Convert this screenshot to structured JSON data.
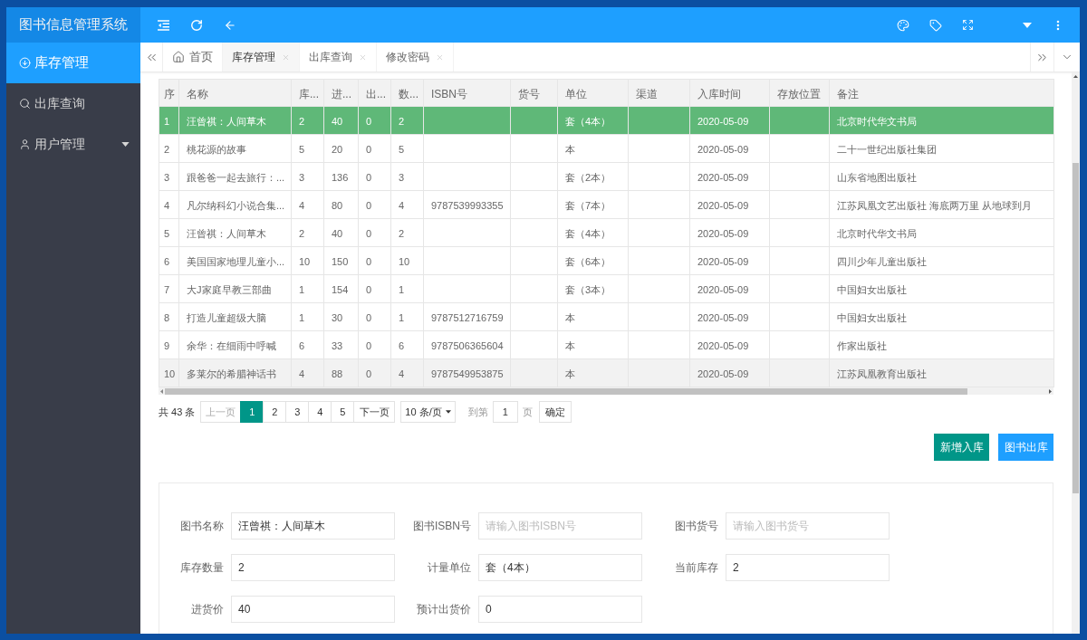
{
  "header": {
    "title": "图书信息管理系统"
  },
  "sidebar": {
    "items": [
      {
        "label": "库存管理",
        "selected": true,
        "kind": "link"
      },
      {
        "label": "出库查询",
        "selected": false,
        "kind": "link"
      },
      {
        "label": "用户管理",
        "selected": false,
        "kind": "group"
      }
    ]
  },
  "tabs": [
    {
      "label": "首页",
      "selected": false,
      "kind": "home"
    },
    {
      "label": "库存管理",
      "selected": true,
      "kind": "page"
    },
    {
      "label": "出库查询",
      "selected": false,
      "kind": "page"
    },
    {
      "label": "修改密码",
      "selected": false,
      "kind": "page"
    }
  ],
  "table": {
    "columns": [
      "序",
      "名称",
      "库...",
      "进...",
      "出...",
      "数...",
      "ISBN号",
      "货号",
      "单位",
      "渠道",
      "入库时间",
      "存放位置",
      "备注"
    ],
    "rows": [
      {
        "selected": true,
        "hovered": false,
        "seq": "1",
        "name": "汪曾祺：人间草木",
        "column_3": "2",
        "column_4": "40",
        "column_5": "0",
        "column_6": "2",
        "unit": "套（4本）",
        "date": "2020-05-09",
        "remark": "北京时代华文书局"
      },
      {
        "selected": false,
        "hovered": false,
        "seq": "2",
        "name": "桃花源的故事",
        "column_3": "5",
        "column_4": "20",
        "column_5": "0",
        "column_6": "5",
        "unit": "本",
        "date": "2020-05-09",
        "remark": "二十一世纪出版社集团"
      },
      {
        "selected": false,
        "hovered": false,
        "seq": "3",
        "name": "跟爸爸一起去旅行：...",
        "column_3": "3",
        "column_4": "136",
        "column_5": "0",
        "column_6": "3",
        "unit": "套（2本）",
        "date": "2020-05-09",
        "remark": "山东省地图出版社"
      },
      {
        "selected": false,
        "hovered": false,
        "seq": "4",
        "name": "凡尔纳科幻小说合集...",
        "column_3": "4",
        "column_4": "80",
        "column_5": "0",
        "column_6": "4",
        "isbn": "9787539993355",
        "unit": "套（7本）",
        "date": "2020-05-09",
        "remark": "江苏凤凰文艺出版社 海底两万里 从地球到月"
      },
      {
        "selected": false,
        "hovered": false,
        "seq": "5",
        "name": "汪曾祺：人间草木",
        "column_3": "2",
        "column_4": "40",
        "column_5": "0",
        "column_6": "2",
        "unit": "套（4本）",
        "date": "2020-05-09",
        "remark": "北京时代华文书局"
      },
      {
        "selected": false,
        "hovered": false,
        "seq": "6",
        "name": "美国国家地理儿童小...",
        "column_3": "10",
        "column_4": "150",
        "column_5": "0",
        "column_6": "10",
        "unit": "套（6本）",
        "date": "2020-05-09",
        "remark": "四川少年儿童出版社"
      },
      {
        "selected": false,
        "hovered": false,
        "seq": "7",
        "name": "大J家庭早教三部曲",
        "column_3": "1",
        "column_4": "154",
        "column_5": "0",
        "column_6": "1",
        "unit": "套（3本）",
        "date": "2020-05-09",
        "remark": "中国妇女出版社"
      },
      {
        "selected": false,
        "hovered": false,
        "seq": "8",
        "name": "打造儿童超级大脑",
        "column_3": "1",
        "column_4": "30",
        "column_5": "0",
        "column_6": "1",
        "isbn": "9787512716759",
        "unit": "本",
        "date": "2020-05-09",
        "remark": "中国妇女出版社"
      },
      {
        "selected": false,
        "hovered": false,
        "seq": "9",
        "name": "余华：在细雨中呼喊",
        "column_3": "6",
        "column_4": "33",
        "column_5": "0",
        "column_6": "6",
        "isbn": "9787506365604",
        "unit": "本",
        "date": "2020-05-09",
        "remark": "作家出版社"
      },
      {
        "selected": false,
        "hovered": true,
        "seq": "10",
        "name": "多莱尔的希腊神话书",
        "column_3": "4",
        "column_4": "88",
        "column_5": "0",
        "column_6": "4",
        "isbn": "9787549953875",
        "unit": "本",
        "date": "2020-05-09",
        "remark": "江苏凤凰教育出版社"
      }
    ]
  },
  "pagination": {
    "total": "共 43 条",
    "prev": {
      "label": "上一页",
      "disabled": true
    },
    "pages": [
      {
        "label": "1",
        "selected": true
      },
      {
        "label": "2",
        "selected": false
      },
      {
        "label": "3",
        "selected": false
      },
      {
        "label": "4",
        "selected": false
      },
      {
        "label": "5",
        "selected": false
      }
    ],
    "next": {
      "label": "下一页",
      "disabled": false
    },
    "page_size": "10 条/页",
    "goto_label": "到第",
    "goto_value": "1",
    "goto_unit": "页",
    "confirm": "确定"
  },
  "actions": [
    {
      "label": "新增入库",
      "color": "#009688"
    },
    {
      "label": "图书出库",
      "color": "#1e9fff"
    }
  ],
  "form": {
    "rows": [
      {
        "fields": [
          {
            "label": "图书名称",
            "value": "汪曾祺：人间草木"
          },
          {
            "label": "图书ISBN号",
            "placeholder": "请输入图书ISBN号"
          },
          {
            "label": "图书货号",
            "placeholder": "请输入图书货号"
          }
        ]
      },
      {
        "fields": [
          {
            "label": "库存数量",
            "value": "2"
          },
          {
            "label": "计量单位",
            "value": "套（4本）"
          },
          {
            "label": "当前库存",
            "value": "2"
          }
        ]
      },
      {
        "fields": [
          {
            "label": "进货价",
            "value": "40"
          },
          {
            "label": "预计出货价",
            "value": "0"
          }
        ]
      }
    ]
  }
}
